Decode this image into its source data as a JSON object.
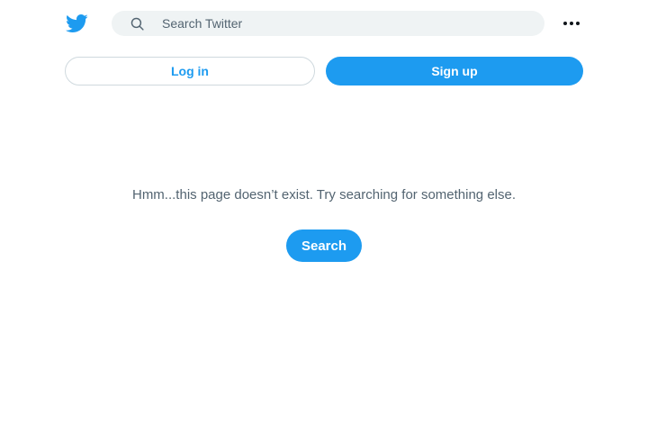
{
  "header": {
    "logo_icon": "twitter-bird-icon",
    "search": {
      "placeholder": "Search Twitter",
      "value": "",
      "icon": "search-icon"
    },
    "more_icon": "more-horizontal-icon"
  },
  "auth": {
    "login_label": "Log in",
    "signup_label": "Sign up"
  },
  "main": {
    "error_message": "Hmm...this page doesn’t exist. Try searching for something else.",
    "search_button_label": "Search"
  },
  "colors": {
    "accent": "#1d9bf0",
    "search_bg": "#eff3f4",
    "secondary_text": "#536471",
    "border": "#cfd9de"
  }
}
